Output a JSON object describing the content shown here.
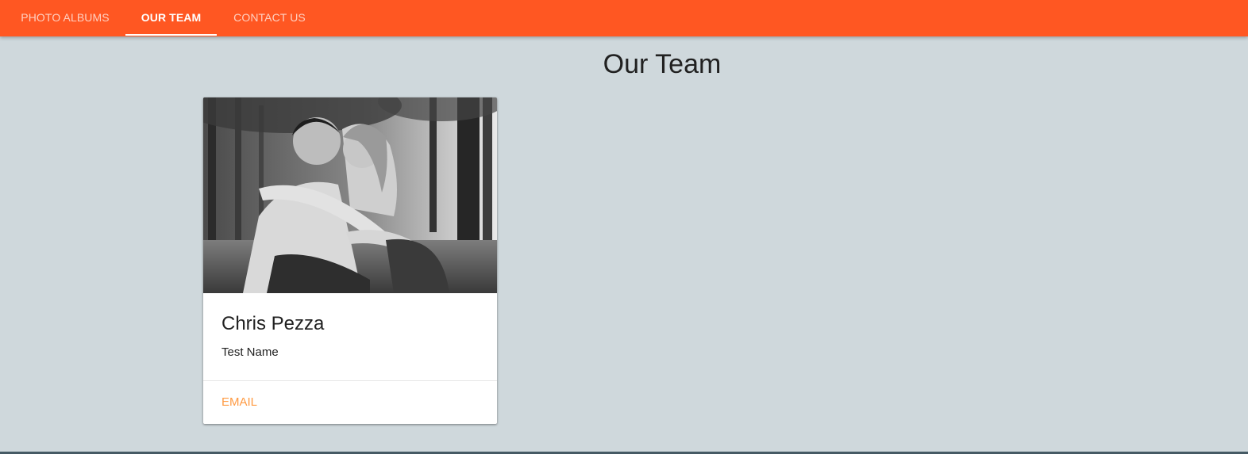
{
  "nav": {
    "tabs": [
      {
        "label": "PHOTO ALBUMS",
        "active": false
      },
      {
        "label": "OUR TEAM",
        "active": true
      },
      {
        "label": "CONTACT US",
        "active": false
      }
    ],
    "bar_color": "#ff5722"
  },
  "page": {
    "title": "Our Team",
    "background": "#cfd8dc"
  },
  "team": {
    "members": [
      {
        "name": "Chris Pezza",
        "subtitle": "Test Name",
        "action_label": "EMAIL",
        "photo": "black-and-white couple photo"
      }
    ]
  },
  "colors": {
    "accent": "#ff9a42",
    "text": "#212121"
  }
}
